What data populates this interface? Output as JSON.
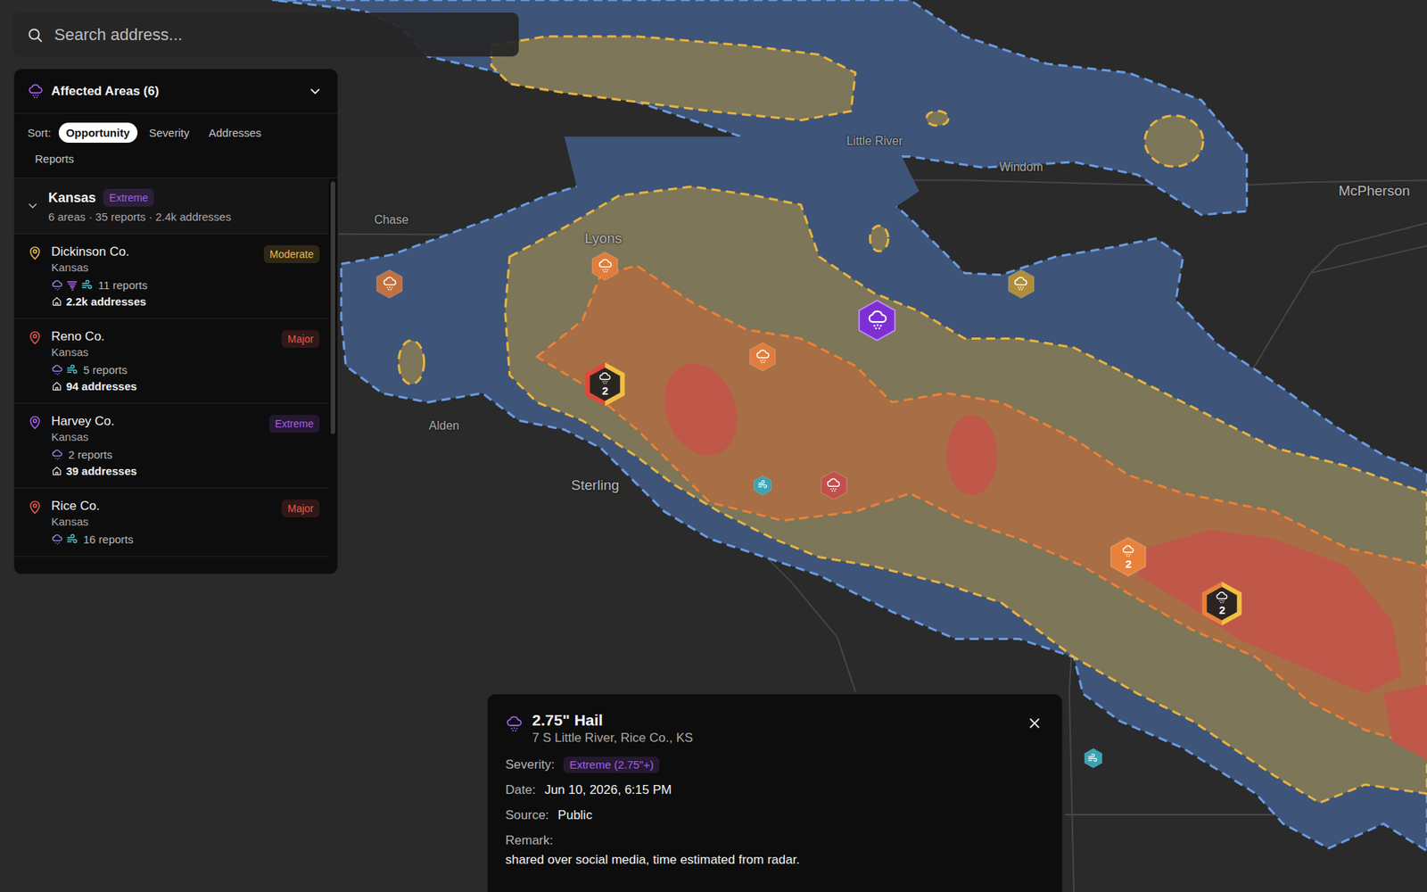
{
  "search": {
    "placeholder": "Search address..."
  },
  "panel": {
    "title": "Affected Areas (6)",
    "expanded": true,
    "sort": {
      "label": "Sort:",
      "options": [
        {
          "label": "Opportunity",
          "selected": true
        },
        {
          "label": "Severity",
          "selected": false
        },
        {
          "label": "Addresses",
          "selected": false
        },
        {
          "label": "Reports",
          "selected": false
        }
      ]
    },
    "groups": [
      {
        "name": "Kansas",
        "badge": "Extreme",
        "color": "#a55cf0",
        "meta": "6 areas · 35 reports · 2.4k addresses",
        "expanded": true,
        "areas": [
          {
            "name": "Dickinson Co.",
            "state": "Kansas",
            "badge": "Moderate",
            "color": "#e8b84a",
            "hazards": [
              "hail",
              "tornado",
              "wind"
            ],
            "reports": "11 reports",
            "addresses": "2.2k addresses"
          },
          {
            "name": "Reno Co.",
            "state": "Kansas",
            "badge": "Major",
            "color": "#e0584e",
            "hazards": [
              "hail",
              "wind"
            ],
            "reports": "5 reports",
            "addresses": "94 addresses"
          },
          {
            "name": "Harvey Co.",
            "state": "Kansas",
            "badge": "Extreme",
            "color": "#a55cf0",
            "hazards": [
              "hail"
            ],
            "reports": "2 reports",
            "addresses": "39 addresses"
          },
          {
            "name": "Rice Co.",
            "state": "Kansas",
            "badge": "Major",
            "color": "#e0584e",
            "hazards": [
              "hail",
              "wind"
            ],
            "reports": "16 reports",
            "addresses": ""
          }
        ]
      }
    ]
  },
  "map": {
    "labels": [
      "Little River",
      "Windom",
      "McPherson",
      "Chase",
      "Lyons",
      "Alden",
      "Sterling"
    ],
    "markers": [
      {
        "kind": "hail",
        "color": "#c2703f",
        "count": "",
        "selected": false
      },
      {
        "kind": "hail",
        "color": "#e07d3c",
        "count": "",
        "selected": false
      },
      {
        "kind": "cluster",
        "color": "#e0483a",
        "count": "2",
        "selected": false
      },
      {
        "kind": "hail",
        "color": "#e07d3c",
        "count": "",
        "selected": false
      },
      {
        "kind": "hail",
        "color": "#7e2fd4",
        "count": "",
        "selected": true
      },
      {
        "kind": "hail",
        "color": "#b08d3a",
        "count": "",
        "selected": false
      },
      {
        "kind": "wind",
        "color": "#3aa3b4",
        "count": "",
        "selected": false
      },
      {
        "kind": "hail",
        "color": "#c2504a",
        "count": "",
        "selected": false
      },
      {
        "kind": "count",
        "color": "#e8823a",
        "count": "2",
        "selected": false
      },
      {
        "kind": "cluster",
        "color": "#e8823a",
        "count": "2",
        "selected": false
      },
      {
        "kind": "wind",
        "color": "#3aa3b4",
        "count": "",
        "selected": false
      }
    ]
  },
  "popup": {
    "title": "2.75\" Hail",
    "subtitle": "7 S Little River, Rice Co., KS",
    "fields": [
      {
        "label": "Severity:",
        "value": "Extreme (2.75\"+)",
        "kind": "badge",
        "color": "#a55cf0"
      },
      {
        "label": "Date:",
        "value": "Jun 10, 2026, 6:15 PM",
        "kind": "text",
        "color": ""
      },
      {
        "label": "Source:",
        "value": "Public",
        "kind": "text",
        "color": ""
      }
    ],
    "remark": {
      "label": "Remark:",
      "value": "shared over social media, time estimated from radar."
    }
  }
}
